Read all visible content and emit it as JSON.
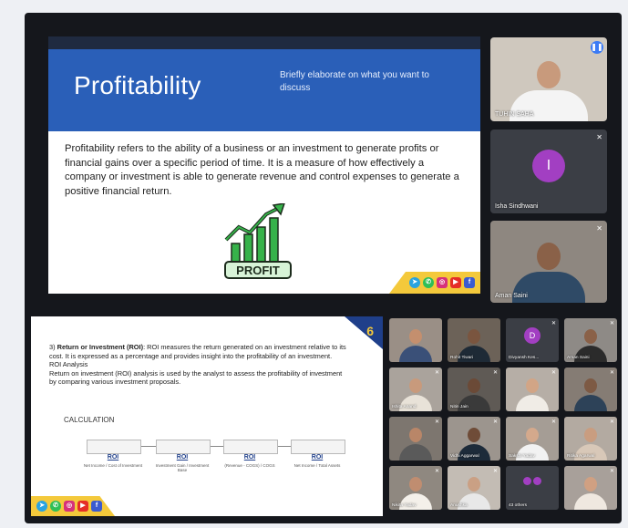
{
  "slide_main": {
    "title": "Profitability",
    "subtitle": "Briefly elaborate on what you want to discuss",
    "body": "Profitability refers to the ability of a business or an investment to generate profits or financial gains over a specific period of time. It is a measure of how effectively a company or investment is able to generate revenue and control expenses to generate a positive financial return.",
    "graphic_label": "PROFIT"
  },
  "slide_secondary": {
    "page_number": "6",
    "heading_prefix": "3) ",
    "heading_bold": "Return or Investment (ROI)",
    "heading_rest": ": ROI measures the return generated on an investment relative to its cost. It is expressed as a percentage and provides insight into the profitability of an investment.",
    "sub_heading": "ROI Analysis",
    "analysis_text": "Return on investment (ROI) analysis is used by the analyst to assess the profitability of investment by comparing various investment proposals.",
    "calculation_label": "CALCULATION",
    "roi_items": [
      {
        "label": "ROI",
        "formula": "Net Income / Cost of Investment"
      },
      {
        "label": "ROI",
        "formula": "Investment Gain / Investment Base"
      },
      {
        "label": "ROI",
        "formula": "(Revenue - COGS) / COGS"
      },
      {
        "label": "ROI",
        "formula": "Net Income / Total Assets"
      }
    ]
  },
  "social_icons": [
    "telegram-icon",
    "whatsapp-icon",
    "instagram-icon",
    "youtube-icon",
    "facebook-icon"
  ],
  "participants_side": [
    {
      "name": "TUHIN SAHA",
      "speaking": true
    },
    {
      "name": "Isha Sindhwani",
      "initial": "I",
      "muted": true
    },
    {
      "name": "Aman Saini",
      "muted": true
    }
  ],
  "participants_grid": [
    {
      "name": "",
      "muted": false
    },
    {
      "name": "Rohit Tiwari",
      "muted": false
    },
    {
      "name": "Divyansh Kes...",
      "initial": "D",
      "muted": true
    },
    {
      "name": "Aman Saini",
      "muted": true
    },
    {
      "name": "Ishita Anand",
      "muted": true
    },
    {
      "name": "Nitin Jain",
      "muted": true
    },
    {
      "name": "",
      "muted": true
    },
    {
      "name": "",
      "muted": true
    },
    {
      "name": "",
      "muted": true
    },
    {
      "name": "Vidhi Aggarwal",
      "muted": true
    },
    {
      "name": "Sakshi Yadav",
      "muted": true
    },
    {
      "name": "Ritika Agarwal",
      "muted": true
    },
    {
      "name": "Nikita Yadav",
      "muted": true
    },
    {
      "name": "Anushka",
      "muted": true
    },
    {
      "name": "43 others",
      "muted": false
    },
    {
      "name": "",
      "muted": true
    }
  ],
  "colors": {
    "banner_blue": "#2a5fb8",
    "accent_yellow": "#f4c93b",
    "meet_background": "#15171c",
    "avatar_purple": "#a23fc2"
  }
}
